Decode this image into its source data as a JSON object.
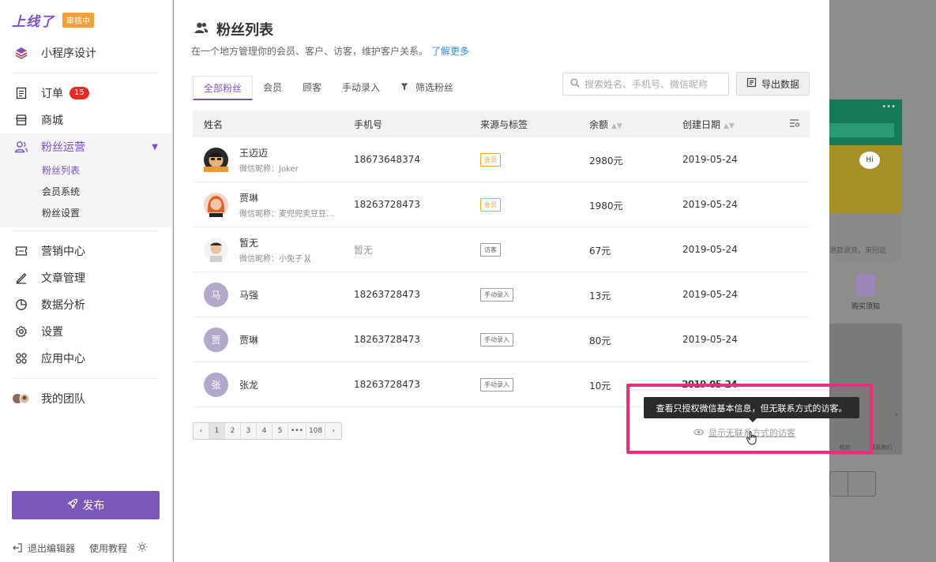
{
  "sidebar": {
    "logo": "上线了",
    "review_badge": "审核中",
    "nav_top": {
      "label": "小程序设计",
      "icon": "layers-icon"
    },
    "orders": {
      "label": "订单",
      "count": "15"
    },
    "mall": {
      "label": "商城"
    },
    "fans_ops": {
      "label": "粉丝运营"
    },
    "sub_items": [
      "粉丝列表",
      "会员系统",
      "粉丝设置"
    ],
    "marketing": {
      "label": "营销中心"
    },
    "articles": {
      "label": "文章管理"
    },
    "analytics": {
      "label": "数据分析"
    },
    "settings": {
      "label": "设置"
    },
    "apps": {
      "label": "应用中心"
    },
    "team": {
      "label": "我的团队"
    },
    "publish": "发布",
    "exit": "退出编辑器",
    "tutorial": "使用教程"
  },
  "main": {
    "title": "粉丝列表",
    "desc": "在一个地方管理你的会员、客户、访客，维护客户关系。",
    "learn_more": "了解更多",
    "tabs": [
      "全部粉丝",
      "会员",
      "顾客",
      "手动录入",
      "筛选粉丝"
    ],
    "search_placeholder": "搜索姓名、手机号、微信昵称",
    "export": "导出数据",
    "columns": {
      "name": "姓名",
      "phone": "手机号",
      "source": "来源与标签",
      "balance": "余额",
      "created": "创建日期"
    },
    "rows": [
      {
        "name": "王迈迈",
        "nick": "微信昵称：Joker",
        "phone": "18673648374",
        "tag": "会员",
        "balance": "2980元",
        "date": "2019-05-24"
      },
      {
        "name": "贾琳",
        "nick": "微信昵称：麦兜兜卖豆豆…",
        "phone": "18263728473",
        "tag": "会员",
        "balance": "1980元",
        "date": "2019-05-24"
      },
      {
        "name": "暂无",
        "nick": "微信昵称：小兔子🐰",
        "phone": "暂无",
        "tag": "访客",
        "balance": "67元",
        "date": "2019-05-24"
      },
      {
        "name": "马强",
        "initial": "马",
        "phone": "18263728473",
        "tag": "手动录入",
        "balance": "13元",
        "date": "2019-05-24"
      },
      {
        "name": "贾琳",
        "initial": "贾",
        "phone": "18263728473",
        "tag": "手动录入",
        "balance": "80元",
        "date": "2019-05-24"
      },
      {
        "name": "张龙",
        "initial": "张",
        "phone": "18263728473",
        "tag": "手动录入",
        "balance": "10元",
        "date": "2019-05-24"
      }
    ],
    "pagination": [
      "‹",
      "1",
      "2",
      "3",
      "4",
      "5",
      "•••",
      "108",
      "›"
    ],
    "tooltip": "查看只授权微信基本信息，但无联系方式的访客。",
    "show_visitors": "显示无联系方式的访客"
  },
  "preview": {
    "bubble": "Hi",
    "text": "退款退货，来回运",
    "notice": "购买须知",
    "nav": [
      "我的",
      "联系我们"
    ]
  },
  "colors": {
    "brand": "#7b57b8",
    "review_badge": "#f0a13b",
    "count_badge": "#e02e24",
    "link": "#2d8cf0",
    "highlight": "#ea2d7c"
  }
}
